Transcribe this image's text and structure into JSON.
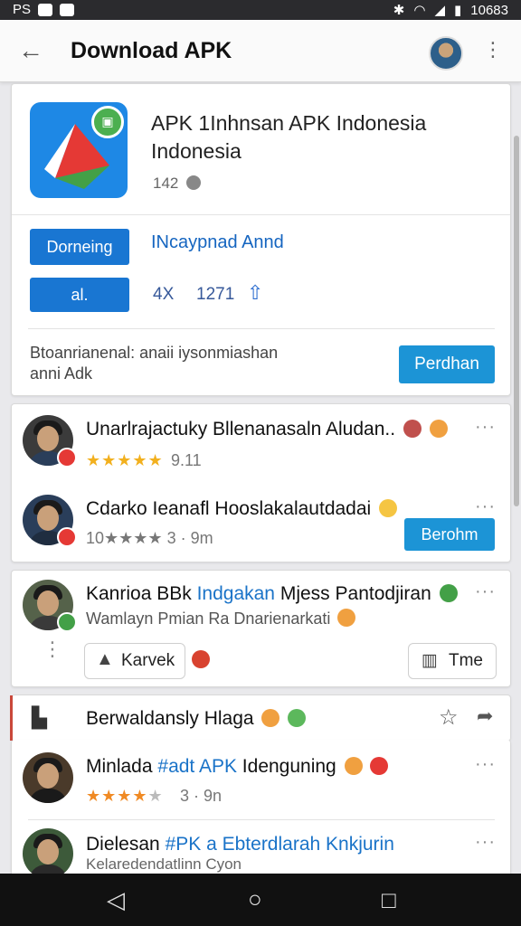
{
  "status_bar": {
    "left_text": "PS",
    "time": "10683"
  },
  "app_bar": {
    "title": "Download APK"
  },
  "app": {
    "title": "APK 1Inhnsan APK Indonesia Indonesia",
    "meta": "142",
    "primary_button": "Dorneing",
    "secondary_link": "INcaypnad Annd",
    "action_button": "al.",
    "stat_1": "4X",
    "stat_2": "1271",
    "description": "Btoanrianenal: anaii iysonmiashan anni Adk",
    "description_button": "Perdhan"
  },
  "reviews_1": [
    {
      "name": "Unarlrajactuky Bllenanasaln Aludan..",
      "rating_text": "9.11",
      "stars": 5
    },
    {
      "name": "Cdarko Ieanafl Hooslakalautdadai",
      "rating_text": "10★★★★ 3 · 9m",
      "button": "Berohm"
    }
  ],
  "post": {
    "title_part1": "Kanrioa BBk ",
    "title_link": "Indgakan",
    "title_part2": " Mjess Pantodjiran",
    "subtitle": "Wamlayn Pmian Ra Dnarienarkati",
    "chip_left": "Karvek",
    "chip_right": "Tme"
  },
  "section_header": {
    "label": "Berwaldansly Hlaga"
  },
  "reviews_2": [
    {
      "name_part1": "Minlada ",
      "name_link": "#adt APK",
      "name_part2": " Idenguning",
      "rating_text": "3 · 9n",
      "stars": 4
    },
    {
      "name_part1": "Dielesan ",
      "name_link": "#PK a",
      "name_part2": " Ebterdlarah Knkjurin",
      "subtitle": "Kelaredendatlinn Cyon"
    }
  ],
  "colors": {
    "accent": "#1976d2",
    "teal_button": "#1c94d6",
    "star": "#f2b01e"
  }
}
